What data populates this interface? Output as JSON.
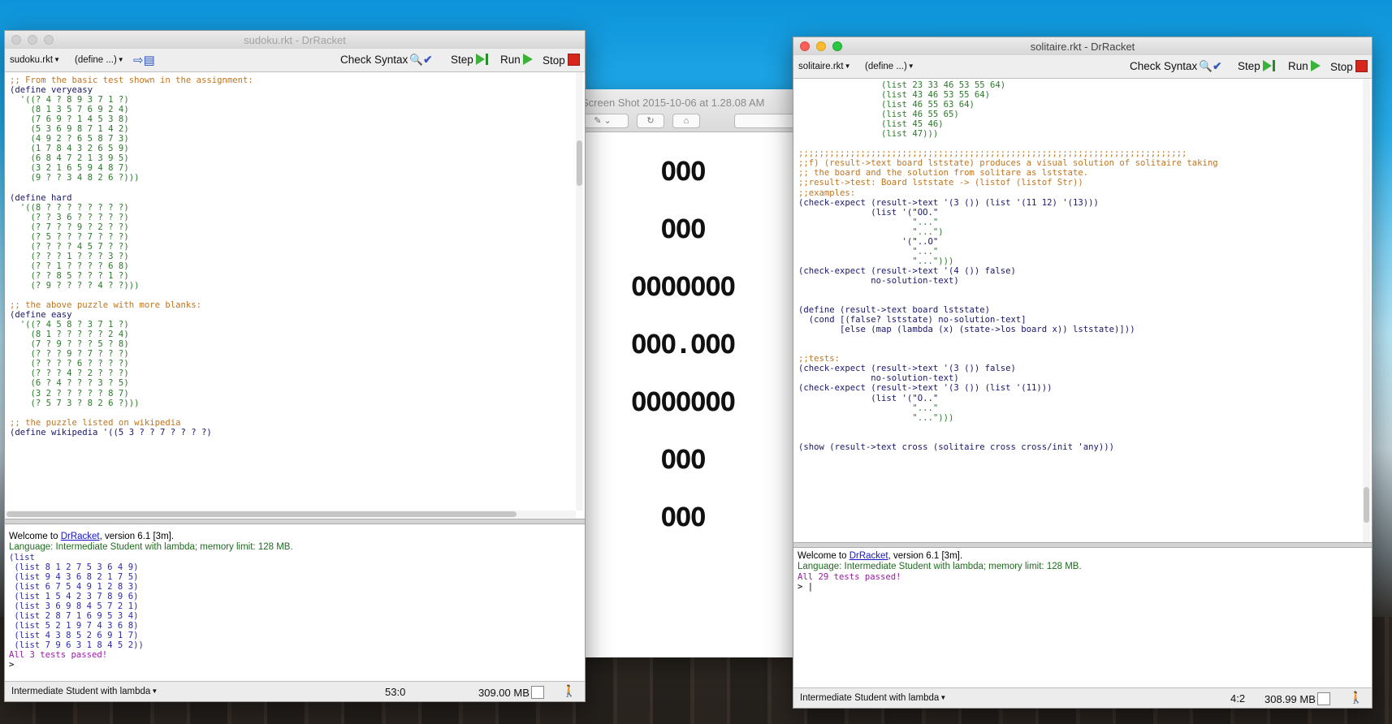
{
  "desktop": {
    "label": "desktop"
  },
  "preview": {
    "title": "Screen Shot 2015-10-06 at 1.28.08 AM",
    "tool_pen": "✎",
    "tool_chevron": "⌄",
    "tool_rotate": "↻",
    "tool_briefcase": "⌂",
    "board_rows": [
      "OOO",
      "OOO",
      "OOOOOOO",
      "OOO.OOO",
      "OOOOOOO",
      "OOO",
      "OOO"
    ]
  },
  "left": {
    "title": "sudoku.rkt - DrRacket",
    "file_menu": "sudoku.rkt",
    "define_menu": "(define ...)",
    "check_syntax": "Check Syntax",
    "step": "Step",
    "run": "Run",
    "stop": "Stop",
    "code_lines": [
      {
        "c": ";; From the basic test shown in the assignment:",
        "k": "comment"
      },
      {
        "c": "(define veryeasy",
        "k": "def"
      },
      {
        "c": "  '((? 4 ? 8 9 3 7 1 ?)",
        "k": "num"
      },
      {
        "c": "    (8 1 3 5 7 6 9 2 4)",
        "k": "num"
      },
      {
        "c": "    (7 6 9 ? 1 4 5 3 8)",
        "k": "num"
      },
      {
        "c": "    (5 3 6 9 8 7 1 4 2)",
        "k": "num"
      },
      {
        "c": "    (4 9 2 ? 6 5 8 7 3)",
        "k": "num"
      },
      {
        "c": "    (1 7 8 4 3 2 6 5 9)",
        "k": "num"
      },
      {
        "c": "    (6 8 4 7 2 1 3 9 5)",
        "k": "num"
      },
      {
        "c": "    (3 2 1 6 5 9 4 8 7)",
        "k": "num"
      },
      {
        "c": "    (9 ? ? 3 4 8 2 6 ?)))",
        "k": "num"
      },
      {
        "c": "",
        "k": "def"
      },
      {
        "c": "(define hard",
        "k": "def"
      },
      {
        "c": "  '((8 ? ? ? ? ? ? ? ?)",
        "k": "num"
      },
      {
        "c": "    (? ? 3 6 ? ? ? ? ?)",
        "k": "num"
      },
      {
        "c": "    (? 7 ? ? 9 ? 2 ? ?)",
        "k": "num"
      },
      {
        "c": "    (? 5 ? ? ? 7 ? ? ?)",
        "k": "num"
      },
      {
        "c": "    (? ? ? ? 4 5 7 ? ?)",
        "k": "num"
      },
      {
        "c": "    (? ? ? 1 ? ? ? 3 ?)",
        "k": "num"
      },
      {
        "c": "    (? ? 1 ? ? ? ? 6 8)",
        "k": "num"
      },
      {
        "c": "    (? ? 8 5 ? ? ? 1 ?)",
        "k": "num"
      },
      {
        "c": "    (? 9 ? ? ? ? 4 ? ?)))",
        "k": "num"
      },
      {
        "c": "",
        "k": "def"
      },
      {
        "c": ";; the above puzzle with more blanks:",
        "k": "comment"
      },
      {
        "c": "(define easy",
        "k": "def"
      },
      {
        "c": "  '((? 4 5 8 ? 3 7 1 ?)",
        "k": "num"
      },
      {
        "c": "    (8 1 ? ? ? ? ? 2 4)",
        "k": "num"
      },
      {
        "c": "    (7 ? 9 ? ? ? 5 ? 8)",
        "k": "num"
      },
      {
        "c": "    (? ? ? 9 ? 7 ? ? ?)",
        "k": "num"
      },
      {
        "c": "    (? ? ? ? 6 ? ? ? ?)",
        "k": "num"
      },
      {
        "c": "    (? ? ? 4 ? 2 ? ? ?)",
        "k": "num"
      },
      {
        "c": "    (6 ? 4 ? ? ? 3 ? 5)",
        "k": "num"
      },
      {
        "c": "    (3 2 ? ? ? ? ? 8 7)",
        "k": "num"
      },
      {
        "c": "    (? 5 7 3 ? 8 2 6 ?)))",
        "k": "num"
      },
      {
        "c": "",
        "k": "def"
      },
      {
        "c": ";; the puzzle listed on wikipedia",
        "k": "comment"
      },
      {
        "c": "(define wikipedia '((5 3 ? ? 7 ? ? ? ?)",
        "k": "def"
      }
    ],
    "welcome_prefix": "Welcome to ",
    "welcome_link": "DrRacket",
    "welcome_suffix": ", version 6.1 [3m].",
    "language_line": "Language: Intermediate Student with lambda; memory limit: 128 MB.",
    "output_lines": [
      "(list",
      " (list 8 1 2 7 5 3 6 4 9)",
      " (list 9 4 3 6 8 2 1 7 5)",
      " (list 6 7 5 4 9 1 2 8 3)",
      " (list 1 5 4 2 3 7 8 9 6)",
      " (list 3 6 9 8 4 5 7 2 1)",
      " (list 2 8 7 1 6 9 5 3 4)",
      " (list 5 2 1 9 7 4 3 6 8)",
      " (list 4 3 8 5 2 6 9 1 7)",
      " (list 7 9 6 3 1 8 4 5 2))"
    ],
    "tests_passed": "All 3 tests passed!",
    "prompt": ">",
    "status_language": "Intermediate Student with lambda",
    "status_pos": "53:0",
    "status_mem": "309.00 MB"
  },
  "right": {
    "title": "solitaire.rkt - DrRacket",
    "file_menu": "solitaire.rkt",
    "define_menu": "(define ...)",
    "check_syntax": "Check Syntax",
    "step": "Step",
    "run": "Run",
    "stop": "Stop",
    "code_lines": [
      {
        "c": "                (list 23 33 46 53 55 64)",
        "k": "num"
      },
      {
        "c": "                (list 43 46 53 55 64)",
        "k": "num"
      },
      {
        "c": "                (list 46 55 63 64)",
        "k": "num"
      },
      {
        "c": "                (list 46 55 65)",
        "k": "num"
      },
      {
        "c": "                (list 45 46)",
        "k": "num"
      },
      {
        "c": "                (list 47)))",
        "k": "num"
      },
      {
        "c": "",
        "k": "def"
      },
      {
        "c": ";;;;;;;;;;;;;;;;;;;;;;;;;;;;;;;;;;;;;;;;;;;;;;;;;;;;;;;;;;;;;;;;;;;;;;;;;;;",
        "k": "comment"
      },
      {
        "c": ";;f) (result->text board lststate) produces a visual solution of solitaire taking",
        "k": "comment"
      },
      {
        "c": ";; the board and the solution from solitare as lststate.",
        "k": "comment"
      },
      {
        "c": ";;result->test: Board lststate -> (listof (listof Str))",
        "k": "comment"
      },
      {
        "c": ";;examples:",
        "k": "comment"
      },
      {
        "c": "(check-expect (result->text '(3 ()) (list '(11 12) '(13)))",
        "k": "def"
      },
      {
        "c": "              (list '(\"OO.\"",
        "k": "def"
      },
      {
        "c": "                      \"...\"",
        "k": "str"
      },
      {
        "c": "                      \"...\")",
        "k": "str"
      },
      {
        "c": "                    '(\"..O\"",
        "k": "def"
      },
      {
        "c": "                      \"...\"",
        "k": "str"
      },
      {
        "c": "                      \"...\")))",
        "k": "str"
      },
      {
        "c": "(check-expect (result->text '(4 ()) false)",
        "k": "def"
      },
      {
        "c": "              no-solution-text)",
        "k": "def"
      },
      {
        "c": "",
        "k": "def"
      },
      {
        "c": "",
        "k": "def"
      },
      {
        "c": "(define (result->text board lststate)",
        "k": "def"
      },
      {
        "c": "  (cond [(false? lststate) no-solution-text]",
        "k": "def"
      },
      {
        "c": "        [else (map (lambda (x) (state->los board x)) lststate)]))",
        "k": "def"
      },
      {
        "c": "",
        "k": "def"
      },
      {
        "c": "",
        "k": "def"
      },
      {
        "c": ";;tests:",
        "k": "comment"
      },
      {
        "c": "(check-expect (result->text '(3 ()) false)",
        "k": "def"
      },
      {
        "c": "              no-solution-text)",
        "k": "def"
      },
      {
        "c": "(check-expect (result->text '(3 ()) (list '(11)))",
        "k": "def"
      },
      {
        "c": "              (list '(\"O..\"",
        "k": "def"
      },
      {
        "c": "                      \"...\"",
        "k": "str"
      },
      {
        "c": "                      \"...\")))",
        "k": "str"
      },
      {
        "c": "",
        "k": "def"
      },
      {
        "c": "",
        "k": "def"
      },
      {
        "c": "(show (result->text cross (solitaire cross cross/init 'any)))",
        "k": "def"
      }
    ],
    "welcome_prefix": "Welcome to ",
    "welcome_link": "DrRacket",
    "welcome_suffix": ", version 6.1 [3m].",
    "language_line": "Language: Intermediate Student with lambda; memory limit: 128 MB.",
    "tests_passed": "All 29 tests passed!",
    "prompt": "> |",
    "status_language": "Intermediate Student with lambda",
    "status_pos": "4:2",
    "status_mem": "308.99 MB"
  }
}
